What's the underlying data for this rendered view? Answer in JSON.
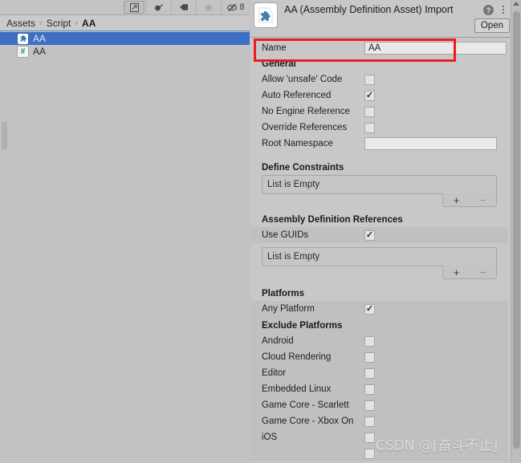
{
  "project_panel": {
    "toolbar": {
      "icons": [
        {
          "name": "open-in-new-icon",
          "glyph": "external"
        },
        {
          "name": "paint-dropper-icon",
          "glyph": "dropper"
        },
        {
          "name": "tag-icon",
          "glyph": "tag"
        },
        {
          "name": "favorite-star-icon",
          "glyph": "star"
        },
        {
          "name": "visibility-off-icon",
          "glyph": "eye-slash"
        }
      ],
      "hidden_count": "8"
    },
    "breadcrumb": {
      "root": "Assets",
      "sep": "›",
      "folder": "Script",
      "current": "AA"
    },
    "assets": [
      {
        "name": "AA",
        "icon": "assembly-definition-icon",
        "selected": true
      },
      {
        "name": "AA",
        "icon": "csharp-script-icon",
        "selected": false
      }
    ]
  },
  "inspector": {
    "title": "AA (Assembly Definition Asset) Import",
    "icon": "assembly-definition-icon",
    "help_label": "?",
    "open_button": "Open",
    "name_field": {
      "label": "Name",
      "value": "AA"
    },
    "general": {
      "heading": "General",
      "fields": [
        {
          "label": "Allow 'unsafe' Code",
          "type": "checkbox",
          "checked": false
        },
        {
          "label": "Auto Referenced",
          "type": "checkbox",
          "checked": true
        },
        {
          "label": "No Engine Reference",
          "type": "checkbox",
          "checked": false
        },
        {
          "label": "Override References",
          "type": "checkbox",
          "checked": false
        },
        {
          "label": "Root Namespace",
          "type": "text",
          "value": ""
        }
      ]
    },
    "define_constraints": {
      "heading": "Define Constraints",
      "empty_text": "List is Empty",
      "add_label": "+",
      "remove_label": "−"
    },
    "assembly_definition_references": {
      "heading": "Assembly Definition References",
      "use_guids_label": "Use GUIDs",
      "use_guids_checked": true,
      "empty_text": "List is Empty",
      "add_label": "+",
      "remove_label": "−"
    },
    "platforms": {
      "heading": "Platforms",
      "any_platform_label": "Any Platform",
      "any_platform_checked": true,
      "exclude_heading": "Exclude Platforms",
      "exclude_list": [
        {
          "label": "Android",
          "checked": false
        },
        {
          "label": "Cloud Rendering",
          "checked": false
        },
        {
          "label": "Editor",
          "checked": false
        },
        {
          "label": "Embedded Linux",
          "checked": false
        },
        {
          "label": "Game Core - Scarlett",
          "checked": false
        },
        {
          "label": "Game Core - Xbox On",
          "checked": false
        },
        {
          "label": "iOS",
          "checked": false
        }
      ]
    }
  },
  "annotation": {
    "color": "#ee1c1c"
  },
  "watermark": "CSDN @[奋斗不止]"
}
